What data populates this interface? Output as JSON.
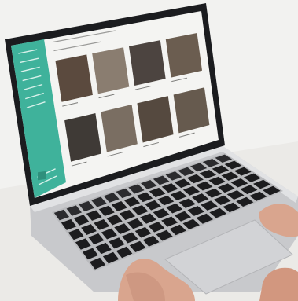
{
  "scene": {
    "description_hidden": "",
    "colors": {
      "background": "#f3f3f1",
      "desk": "#ecebe8",
      "laptop_shell": "#c9cacd",
      "laptop_shell_light": "#dfe0e2",
      "bezel": "#1b1c1f",
      "screen_bg": "#f4f4f2",
      "sidebar": "#3fb29b",
      "sidebar_dark": "#2f8f7c",
      "key": "#1c1c1e",
      "key_top": "#2a2a2d",
      "trackpad": "#cfd0d3",
      "skin": "#d9a58e",
      "skin_shadow": "#b97f69"
    },
    "icons": [
      "laptop-icon",
      "hand-icon"
    ]
  }
}
